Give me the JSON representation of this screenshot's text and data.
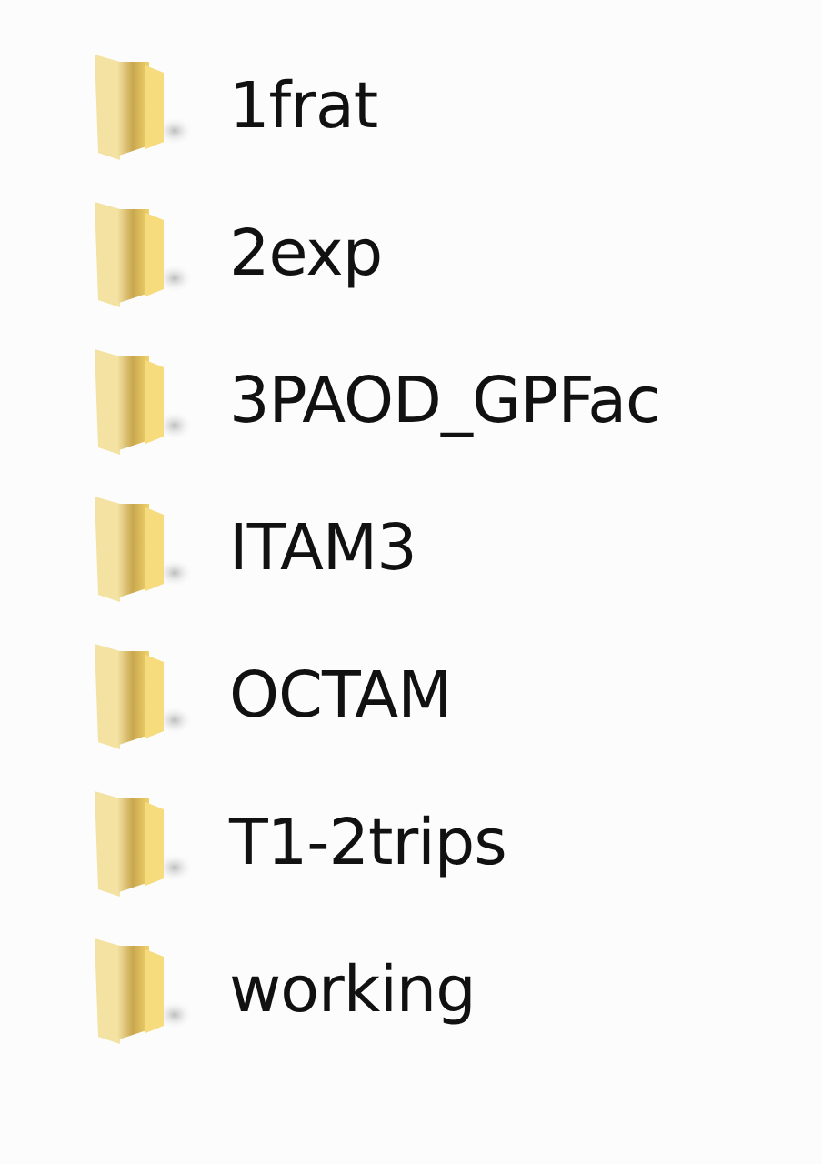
{
  "folders": [
    {
      "name": "1frat"
    },
    {
      "name": "2exp"
    },
    {
      "name": "3PAOD_GPFac"
    },
    {
      "name": "ITAM3"
    },
    {
      "name": "OCTAM"
    },
    {
      "name": "T1-2trips"
    },
    {
      "name": "working"
    }
  ]
}
